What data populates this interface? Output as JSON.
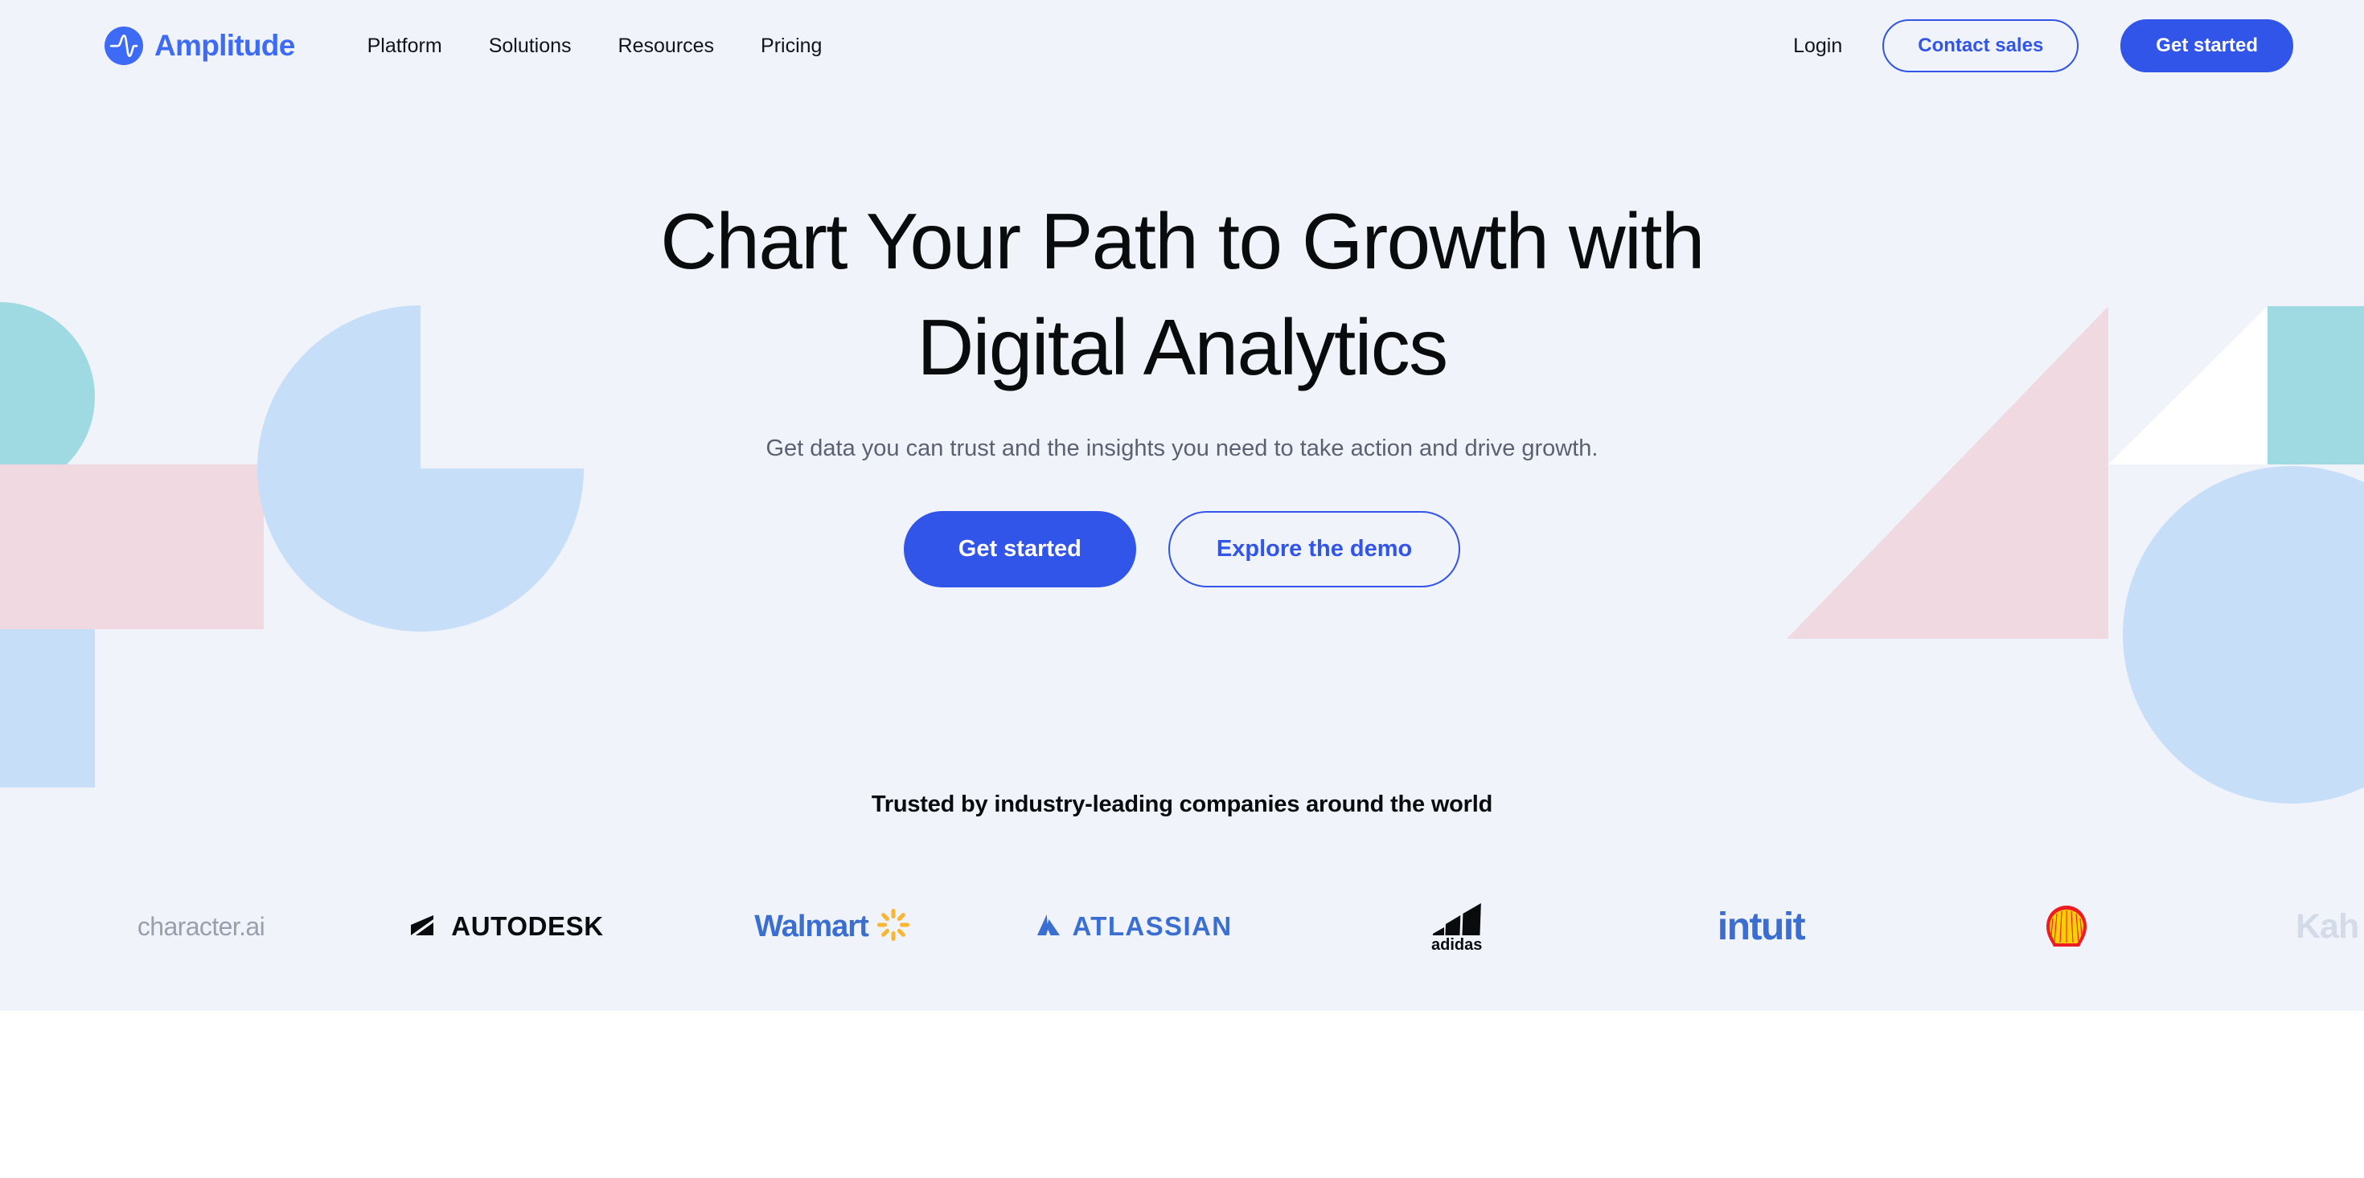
{
  "brand": {
    "name": "Amplitude",
    "logo_color": "#3e6bf5"
  },
  "nav": {
    "links": [
      {
        "label": "Platform"
      },
      {
        "label": "Solutions"
      },
      {
        "label": "Resources"
      },
      {
        "label": "Pricing"
      }
    ],
    "login_label": "Login",
    "contact_sales_label": "Contact sales",
    "get_started_label": "Get started"
  },
  "hero": {
    "title_line1": "Chart Your Path to Growth with",
    "title_line2": "Digital Analytics",
    "subtitle": "Get data you can trust and the insights you need to take action and drive growth.",
    "cta_primary": "Get started",
    "cta_secondary": "Explore the demo",
    "background_color": "#f0f3fa"
  },
  "trusted": {
    "title": "Trusted by industry-leading companies around the world",
    "logos": [
      {
        "name": "character.ai",
        "label": "character.ai",
        "color": "#9aa0ab"
      },
      {
        "name": "autodesk",
        "label": "AUTODESK",
        "color": "#0a0b0d"
      },
      {
        "name": "walmart",
        "label": "Walmart",
        "color": "#3a6fd1",
        "accent": "#f7b731"
      },
      {
        "name": "atlassian",
        "label": "ATLASSIAN",
        "color": "#3a6fd1"
      },
      {
        "name": "adidas",
        "label": "adidas",
        "color": "#0a0b0d"
      },
      {
        "name": "intuit",
        "label": "intuit",
        "color": "#3a6fd1"
      },
      {
        "name": "shell",
        "label": "Shell",
        "color": "#ed1c24",
        "accent": "#fbce07"
      },
      {
        "name": "kahoot",
        "label": "Kah",
        "color": "#d3dae8"
      }
    ]
  },
  "theme": {
    "accent_blue": "#3155e8",
    "deco_light_blue": "#c7def9",
    "deco_teal": "#9fd9e2",
    "deco_pink": "#f0d9e0",
    "text_dark": "#0a0b0d",
    "text_muted": "#5b6170"
  }
}
